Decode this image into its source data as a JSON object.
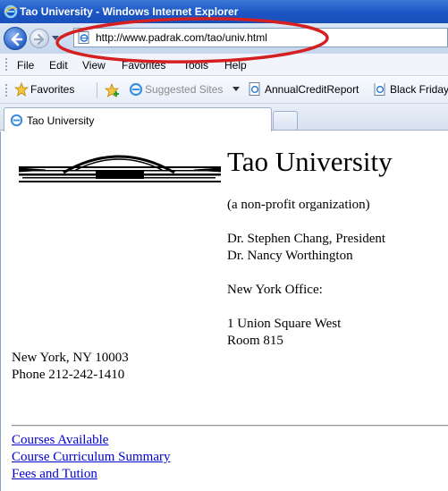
{
  "window": {
    "title": "Tao University - Windows Internet Explorer"
  },
  "address": {
    "url": "http://www.padrak.com/tao/univ.html"
  },
  "menu": [
    "File",
    "Edit",
    "View",
    "Favorites",
    "Tools",
    "Help"
  ],
  "favorites_bar": {
    "favorites_label": "Favorites",
    "items": [
      {
        "label": "Suggested Sites",
        "icon": "ie-icon",
        "muted": true,
        "has_dropdown": true
      },
      {
        "label": "AnnualCreditReport",
        "icon": "page-icon"
      },
      {
        "label": "Black Friday",
        "icon": "page-icon"
      }
    ]
  },
  "tab": {
    "title": "Tao University"
  },
  "page": {
    "title": "Tao University",
    "subtitle": "(a non-profit organization)",
    "president": "Dr. Stephen Chang, President",
    "person2": "Dr. Nancy Worthington",
    "office_heading": "New York Office:",
    "address_line1": "1 Union Square West",
    "address_line2": "Room 815",
    "city": "New York, NY 10003",
    "phone": "Phone 212-242-1410",
    "links": [
      "Courses Available",
      "Course Curriculum Summary",
      "Fees and Tution"
    ]
  },
  "colors": {
    "annotation_ellipse": "#d42020",
    "link": "#0000cc",
    "titlebar": "#1b55c4"
  }
}
